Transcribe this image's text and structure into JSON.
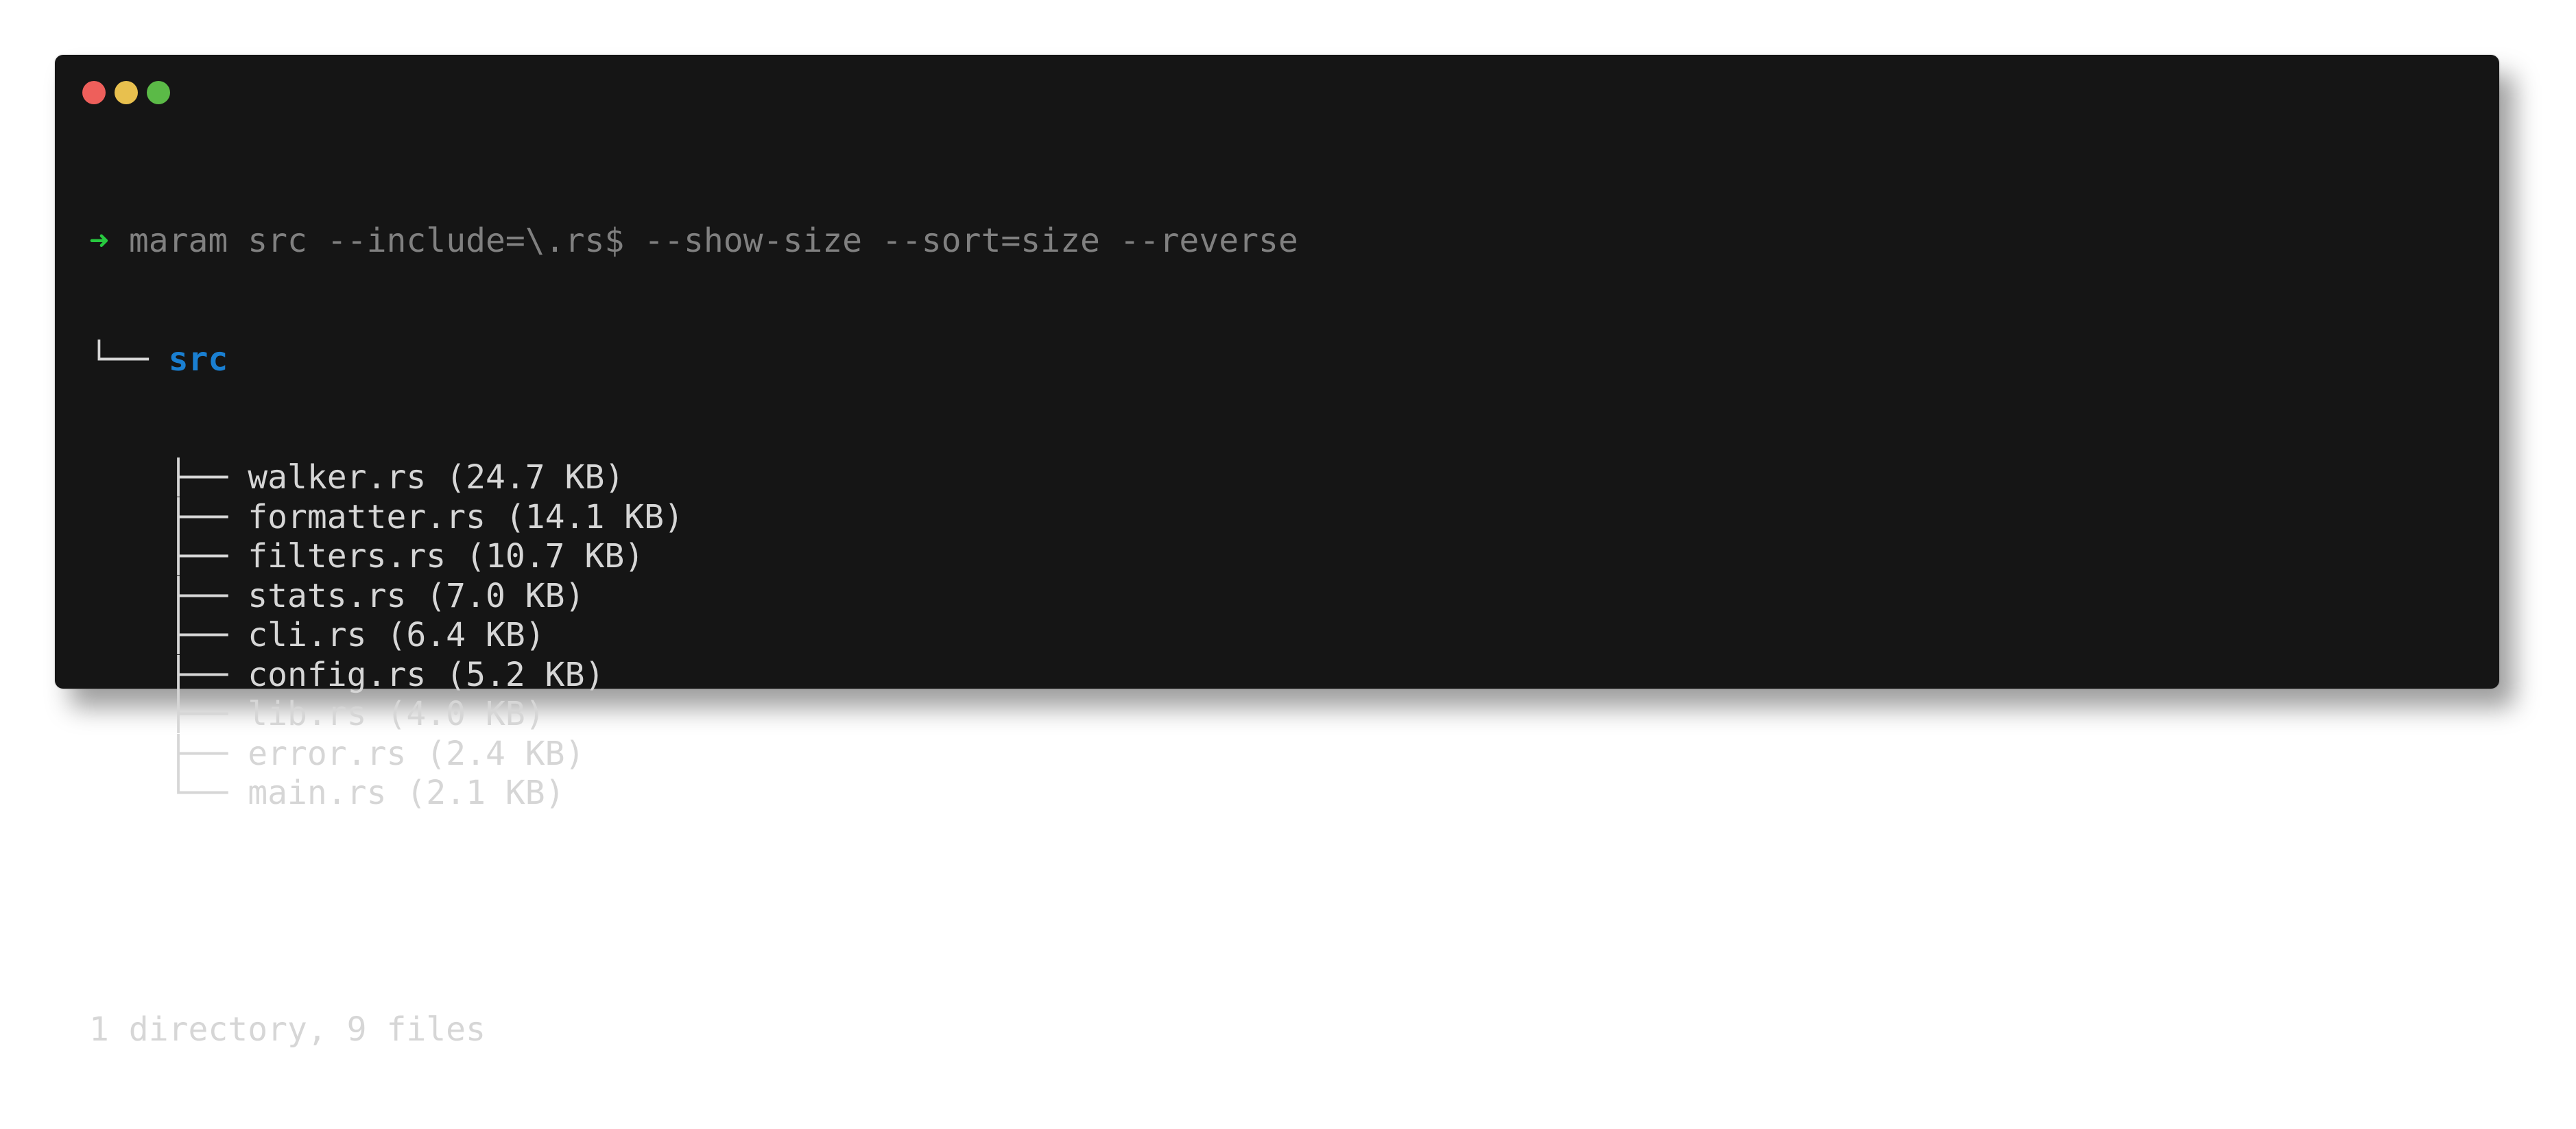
{
  "window": {
    "controls": {
      "close_color": "#ee5f5b",
      "minimize_color": "#e8c04e",
      "maximize_color": "#5bba47"
    }
  },
  "terminal": {
    "prompt_symbol": "➜",
    "command": "maram src --include=\\.rs$ --show-size --sort=size --reverse",
    "root": {
      "connector": "└── ",
      "name": "src",
      "color": "#1a7fd1"
    },
    "entries": [
      {
        "connector": "├── ",
        "label": "walker.rs (24.7 KB)"
      },
      {
        "connector": "├── ",
        "label": "formatter.rs (14.1 KB)"
      },
      {
        "connector": "├── ",
        "label": "filters.rs (10.7 KB)"
      },
      {
        "connector": "├── ",
        "label": "stats.rs (7.0 KB)"
      },
      {
        "connector": "├── ",
        "label": "cli.rs (6.4 KB)"
      },
      {
        "connector": "├── ",
        "label": "config.rs (5.2 KB)"
      },
      {
        "connector": "├── ",
        "label": "lib.rs (4.0 KB)"
      },
      {
        "connector": "├── ",
        "label": "error.rs (2.4 KB)"
      },
      {
        "connector": "└── ",
        "label": "main.rs (2.1 KB)"
      }
    ],
    "summary": "1 directory, 9 files"
  }
}
